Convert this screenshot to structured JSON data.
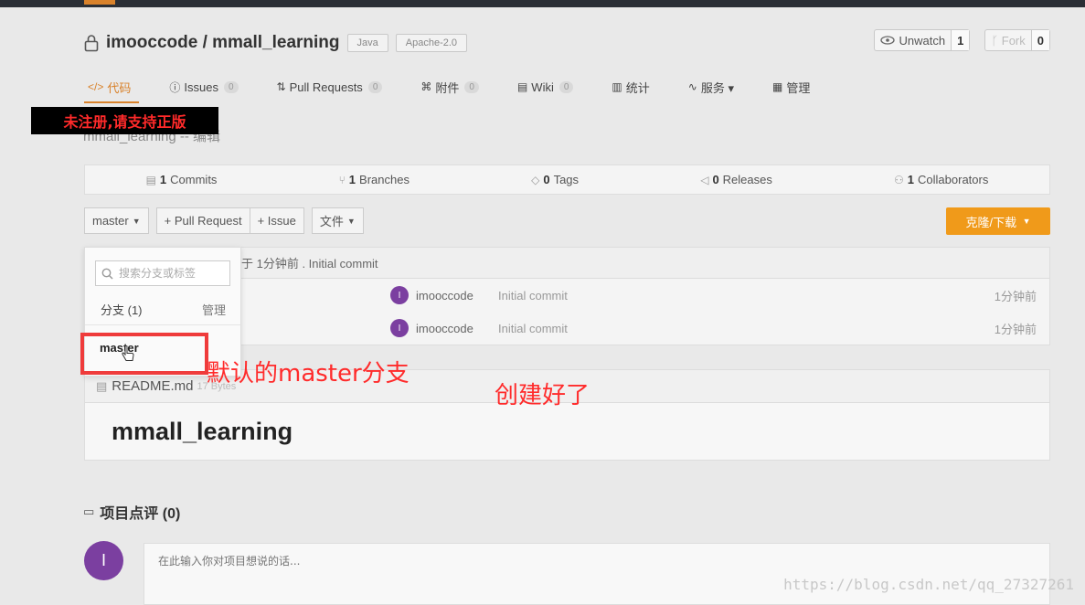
{
  "repo": {
    "title": "imooccode / mmall_learning",
    "tags": [
      "Java",
      "Apache-2.0"
    ],
    "watch_label": "Unwatch",
    "watch_count": "1",
    "fork_label": "Fork",
    "fork_count": "0"
  },
  "tabs": [
    {
      "icon": "</>",
      "label": "代码",
      "count": ""
    },
    {
      "icon": "ⓘ",
      "label": "Issues",
      "count": "0"
    },
    {
      "icon": "⇅",
      "label": "Pull Requests",
      "count": "0"
    },
    {
      "icon": "⌘",
      "label": "附件",
      "count": "0"
    },
    {
      "icon": "▤",
      "label": "Wiki",
      "count": "0"
    },
    {
      "icon": "▥",
      "label": "统计",
      "count": ""
    },
    {
      "icon": "∿",
      "label": "服务 ▾",
      "count": ""
    },
    {
      "icon": "▦",
      "label": "管理",
      "count": ""
    }
  ],
  "banner": "未注册,请支持正版",
  "subtitle": "mmall_learning -- 编辑",
  "stats": [
    {
      "count": "1",
      "label": "Commits"
    },
    {
      "count": "1",
      "label": "Branches"
    },
    {
      "count": "0",
      "label": "Tags"
    },
    {
      "count": "0",
      "label": "Releases"
    },
    {
      "count": "1",
      "label": "Collaborators"
    }
  ],
  "toolbar": {
    "branch": "master",
    "pull_request": "+ Pull Request",
    "issue": "+ Issue",
    "files": "文件",
    "clone": "克隆/下载"
  },
  "commit_head": "于 1分钟前 . Initial commit",
  "files": [
    {
      "avatar": "I",
      "author": "imooccode",
      "message": "Initial commit",
      "time": "1分钟前"
    },
    {
      "avatar": "I",
      "author": "imooccode",
      "message": "Initial commit",
      "time": "1分钟前"
    }
  ],
  "dropdown": {
    "search_placeholder": "搜索分支或标签",
    "branches_label": "分支 (1)",
    "manage_label": "管理",
    "item": "master"
  },
  "annotations": {
    "default_branch": "默认的master分支",
    "created": "创建好了"
  },
  "readme": {
    "filename": "README.md",
    "size": "17 Bytes",
    "heading": "mmall_learning"
  },
  "comments": {
    "title": "项目点评 (0)",
    "avatar": "I",
    "placeholder": "在此输入你对项目想说的话..."
  },
  "watermark": "https://blog.csdn.net/qq_27327261",
  "colors": {
    "accent": "#d9822b",
    "clone": "#f09a1a",
    "annotation": "#ff2b2b",
    "avatar": "#7b3fa0"
  }
}
